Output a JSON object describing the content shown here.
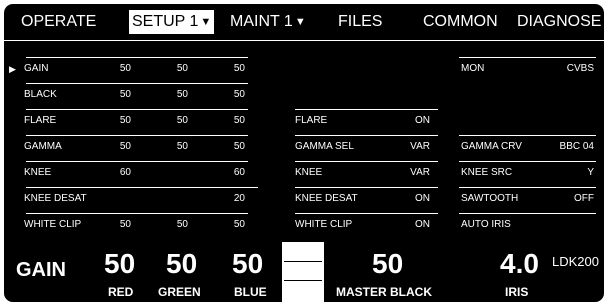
{
  "menu": {
    "operate": "OPERATE",
    "setup": "SETUP 1",
    "maint": "MAINT 1",
    "files": "FILES",
    "common": "COMMON",
    "diagnose": "DIAGNOSE",
    "dropdown_glyph": "▼"
  },
  "cursor_glyph": "▶",
  "left_params": [
    {
      "label": "GAIN",
      "values": [
        "50",
        "50",
        "50"
      ]
    },
    {
      "label": "BLACK",
      "values": [
        "50",
        "50",
        "50"
      ]
    },
    {
      "label": "FLARE",
      "values": [
        "50",
        "50",
        "50"
      ]
    },
    {
      "label": "GAMMA",
      "values": [
        "50",
        "50",
        "50"
      ]
    },
    {
      "label": "KNEE",
      "values": [
        "60",
        "",
        "60"
      ]
    },
    {
      "label": "KNEE DESAT",
      "values": [
        "",
        "",
        "20"
      ]
    },
    {
      "label": "WHITE CLIP",
      "values": [
        "50",
        "50",
        "50"
      ]
    }
  ],
  "mid_params": [
    {
      "label": "FLARE",
      "value": "ON"
    },
    {
      "label": "GAMMA SEL",
      "value": "VAR"
    },
    {
      "label": "KNEE",
      "value": "VAR"
    },
    {
      "label": "KNEE DESAT",
      "value": "ON"
    },
    {
      "label": "WHITE CLIP",
      "value": "ON"
    }
  ],
  "right_params": [
    {
      "label": "MON",
      "value": "CVBS"
    },
    {
      "label": "GAMMA CRV",
      "value": "BBC 04"
    },
    {
      "label": "KNEE SRC",
      "value": "Y"
    },
    {
      "label": "SAWTOOTH",
      "value": "OFF"
    },
    {
      "label": "AUTO IRIS",
      "value": ""
    }
  ],
  "bottom": {
    "title": "GAIN",
    "red_value": "50",
    "red_label": "RED",
    "green_value": "50",
    "green_label": "GREEN",
    "blue_value": "50",
    "blue_label": "BLUE",
    "master_value": "50",
    "master_label": "MASTER BLACK",
    "iris_value": "4.0",
    "iris_label": "IRIS",
    "model": "LDK200"
  }
}
